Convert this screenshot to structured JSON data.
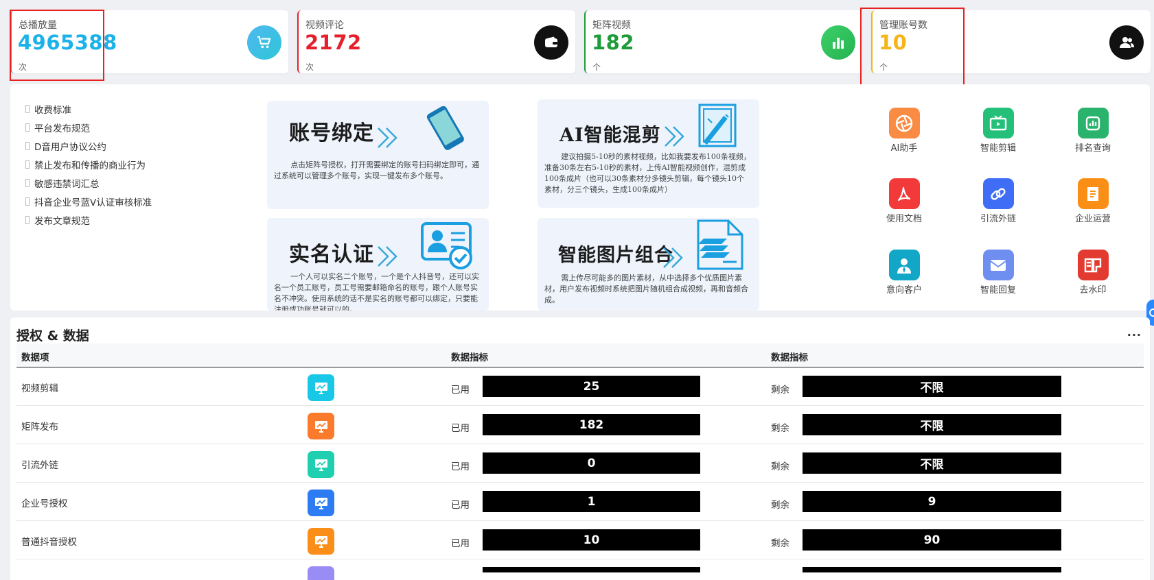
{
  "stats": [
    {
      "title": "总播放量",
      "value": "4965388",
      "unit": "次",
      "color": "#1ab2e8",
      "icon": "cart-icon"
    },
    {
      "title": "视频评论",
      "value": "2172",
      "unit": "次",
      "color": "#e5202c",
      "icon": "wallet-icon"
    },
    {
      "title": "矩阵视频",
      "value": "182",
      "unit": "个",
      "color": "#1e9c3a",
      "icon": "bar-chart-icon"
    },
    {
      "title": "管理账号数",
      "value": "10",
      "unit": "个",
      "color": "#f5b418",
      "icon": "users-icon"
    }
  ],
  "rules": [
    "收费标准",
    "平台发布规范",
    "D音用户协议公约",
    "禁止发布和传播的商业行为",
    "敏感违禁词汇总",
    "抖音企业号蓝V认证审核标准",
    "发布文章规范"
  ],
  "features": [
    {
      "title": "账号绑定",
      "desc": "点击矩阵号授权，打开需要绑定的账号扫码绑定即可，通过系统可以管理多个账号，实现一键发布多个账号。",
      "illustration": "phone-icon"
    },
    {
      "title": "AI智能混剪",
      "desc": "建议拍摄5-10秒的素材视频，比如我要发布100条视频，准备30条左右5-10秒的素材，上传AI智能视频创作，混剪成100条成片（也可以30条素材分多镜头剪辑，每个镜头10个素材，分三个镜头，生成100条成片）",
      "illustration": "video-edit-icon"
    },
    {
      "title": "实名认证",
      "desc": "一个人可以实名二个账号，一个是个人抖音号，还可以实名一个员工账号，员工号需要邮箱命名的账号，跟个人账号实名不冲突。使用系统的话不是实名的账号都可以绑定，只要能注册成功账号就可以的。",
      "illustration": "id-card-icon"
    },
    {
      "title": "智能图片组合",
      "desc": "需上传尽可能多的图片素材，从中选择多个优质图片素材，用户发布视频时系统把图片随机组合成视频，再和音频合成。",
      "illustration": "document-icon"
    }
  ],
  "quick_actions": [
    {
      "label": "AI助手",
      "color": "#f98b43",
      "icon": "ai-assistant-icon"
    },
    {
      "label": "智能剪辑",
      "color": "#24c07a",
      "icon": "tv-icon"
    },
    {
      "label": "排名查询",
      "color": "#29b36c",
      "icon": "ranking-icon"
    },
    {
      "label": "使用文档",
      "color": "#f23a3a",
      "icon": "pdf-icon"
    },
    {
      "label": "引流外链",
      "color": "#3f6df5",
      "icon": "link-icon"
    },
    {
      "label": "企业运营",
      "color": "#fb8f16",
      "icon": "file-icon"
    },
    {
      "label": "意向客户",
      "color": "#12a7c7",
      "icon": "customer-icon"
    },
    {
      "label": "智能回复",
      "color": "#6f8ff0",
      "icon": "mail-icon"
    },
    {
      "label": "去水印",
      "color": "#e23a30",
      "icon": "watermark-icon"
    }
  ],
  "data_section": {
    "title": "授权 & 数据",
    "more": "···",
    "headers": [
      "数据项",
      "数据指标",
      "数据指标"
    ],
    "used_label": "已用",
    "remain_label": "剩余",
    "rows": [
      {
        "name": "视频剪辑",
        "used": "25",
        "remain": "不限",
        "icon_color": "#19c8e6"
      },
      {
        "name": "矩阵发布",
        "used": "182",
        "remain": "不限",
        "icon_color": "#fb7a2c"
      },
      {
        "name": "引流外链",
        "used": "0",
        "remain": "不限",
        "icon_color": "#1fcfb0"
      },
      {
        "name": "企业号授权",
        "used": "1",
        "remain": "9",
        "icon_color": "#2d7cf3"
      },
      {
        "name": "普通抖音授权",
        "used": "10",
        "remain": "90",
        "icon_color": "#fb8d19"
      }
    ],
    "partial_row_icon_color": "#9a8cf5"
  }
}
